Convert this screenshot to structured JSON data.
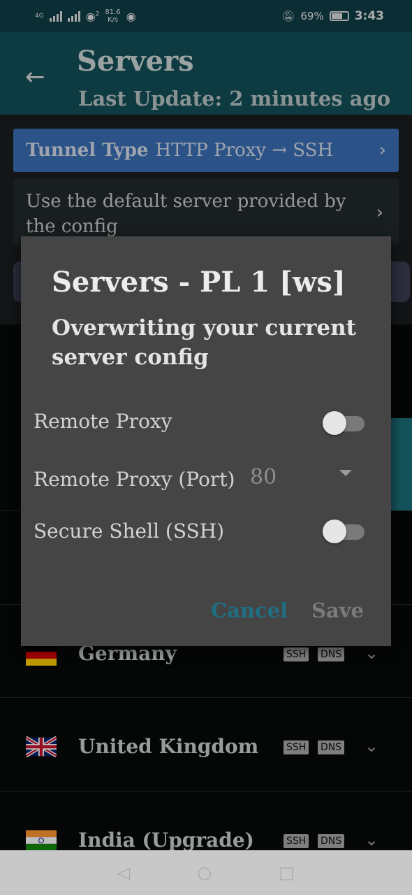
{
  "status_bar": {
    "network_label": "4G",
    "net_speed_value": "81.6",
    "net_speed_unit": "K/s",
    "wifi_badge": "2",
    "battery": "69%",
    "time": "3:43"
  },
  "header": {
    "title": "Servers",
    "subtitle": "Last Update: 2 minutes ago"
  },
  "tunnel": {
    "label": "Tunnel Type",
    "value": "HTTP Proxy → SSH"
  },
  "default_server_text": "Use the default server provided by the config",
  "dialog": {
    "title": "Servers - PL 1 [ws]",
    "message": "Overwriting your current server config",
    "remote_proxy_label": "Remote Proxy",
    "remote_proxy_enabled": false,
    "remote_proxy_port_label": "Remote Proxy (Port)",
    "remote_proxy_port_value": "80",
    "ssh_label": "Secure Shell (SSH)",
    "ssh_enabled": false,
    "cancel_label": "Cancel",
    "save_label": "Save"
  },
  "countries": [
    {
      "name": "Germany",
      "tags": [
        "SSH",
        "DNS"
      ],
      "flag": "de"
    },
    {
      "name": "United Kingdom",
      "tags": [
        "SSH",
        "DNS"
      ],
      "flag": "gb"
    },
    {
      "name": "India (Upgrade)",
      "tags": [
        "SSH",
        "DNS"
      ],
      "flag": "in"
    }
  ],
  "colors": {
    "header_bg": "#124f57",
    "tunnel_bg": "#3b6fb6",
    "dialog_bg": "#454545",
    "cancel_text": "#1e6f83"
  }
}
